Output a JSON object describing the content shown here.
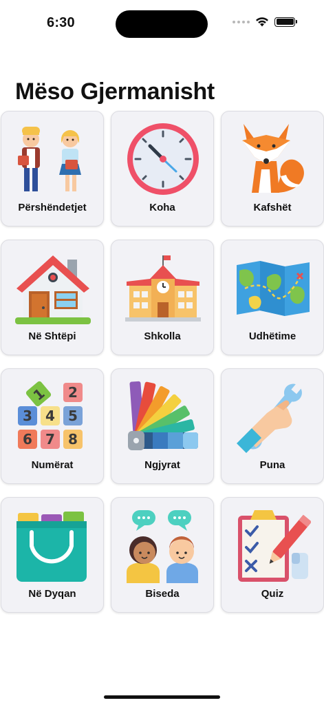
{
  "status_bar": {
    "time": "6:30",
    "icons": [
      "cellular-dots-icon",
      "wifi-icon",
      "battery-icon"
    ]
  },
  "title": "Mëso Gjermanisht",
  "categories": [
    {
      "label": "Përshëndetjet",
      "icon": "greeting-kids-icon"
    },
    {
      "label": "Koha",
      "icon": "clock-icon"
    },
    {
      "label": "Kafshët",
      "icon": "fox-icon"
    },
    {
      "label": "Në Shtëpi",
      "icon": "house-icon"
    },
    {
      "label": "Shkolla",
      "icon": "school-icon"
    },
    {
      "label": "Udhëtime",
      "icon": "map-icon"
    },
    {
      "label": "Numërat",
      "icon": "number-blocks-icon"
    },
    {
      "label": "Ngjyrat",
      "icon": "color-palette-icon"
    },
    {
      "label": "Puna",
      "icon": "wrench-hand-icon"
    },
    {
      "label": "Në Dyqan",
      "icon": "shopping-bag-icon"
    },
    {
      "label": "Biseda",
      "icon": "chat-people-icon"
    },
    {
      "label": "Quiz",
      "icon": "quiz-clipboard-icon"
    }
  ],
  "number_blocks": [
    "1",
    "2",
    "3",
    "4",
    "5",
    "6",
    "7",
    "8"
  ]
}
